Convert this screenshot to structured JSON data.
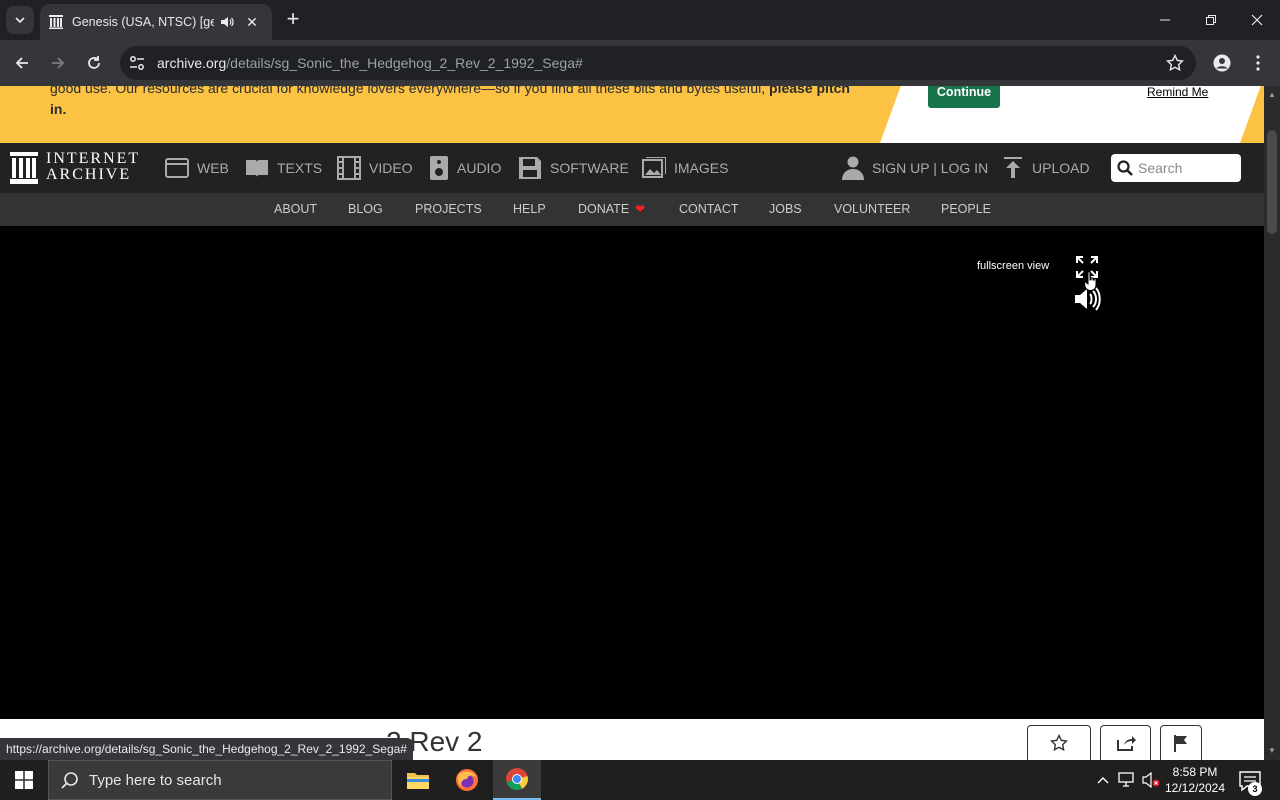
{
  "browser": {
    "tab": {
      "title": "Genesis (USA, NTSC) [genesis]",
      "close_glyph": "✕"
    },
    "new_tab_glyph": "+",
    "url": {
      "host": "archive.org",
      "path": "/details/sg_Sonic_the_Hedgehog_2_Rev_2_1992_Sega#"
    },
    "status_url": "https://archive.org/details/sg_Sonic_the_Hedgehog_2_Rev_2_1992_Sega#"
  },
  "banner": {
    "text": "good use. Our resources are crucial for knowledge lovers everywhere—so if you find all these bits and bytes useful, ",
    "cta_text": "please pitch in.",
    "continue_label": "Continue",
    "remind_label": "Remind Me"
  },
  "ia_header": {
    "logo_line1": "INTERNET",
    "logo_line2": "ARCHIVE",
    "media": [
      {
        "label": "WEB",
        "icon": "web-icon"
      },
      {
        "label": "TEXTS",
        "icon": "book-icon"
      },
      {
        "label": "VIDEO",
        "icon": "film-icon"
      },
      {
        "label": "AUDIO",
        "icon": "speaker-icon"
      },
      {
        "label": "SOFTWARE",
        "icon": "floppy-icon"
      },
      {
        "label": "IMAGES",
        "icon": "image-icon"
      }
    ],
    "signup_login": "SIGN UP | LOG IN",
    "upload": "UPLOAD",
    "search_placeholder": "Search"
  },
  "subnav": [
    "ABOUT",
    "BLOG",
    "PROJECTS",
    "HELP",
    "DONATE",
    "CONTACT",
    "JOBS",
    "VOLUNTEER",
    "PEOPLE"
  ],
  "emulator": {
    "fullscreen_label": "fullscreen view"
  },
  "item": {
    "title_partial": "2 Rev 2"
  },
  "taskbar": {
    "search_placeholder": "Type here to search",
    "time": "8:58 PM",
    "date": "12/12/2024",
    "notification_count": "3"
  },
  "colors": {
    "banner_yellow": "#fbc244",
    "continue_green": "#18744b",
    "ia_dark": "#222222",
    "ia_subnav": "#333333",
    "donate_heart": "#ee2222"
  }
}
